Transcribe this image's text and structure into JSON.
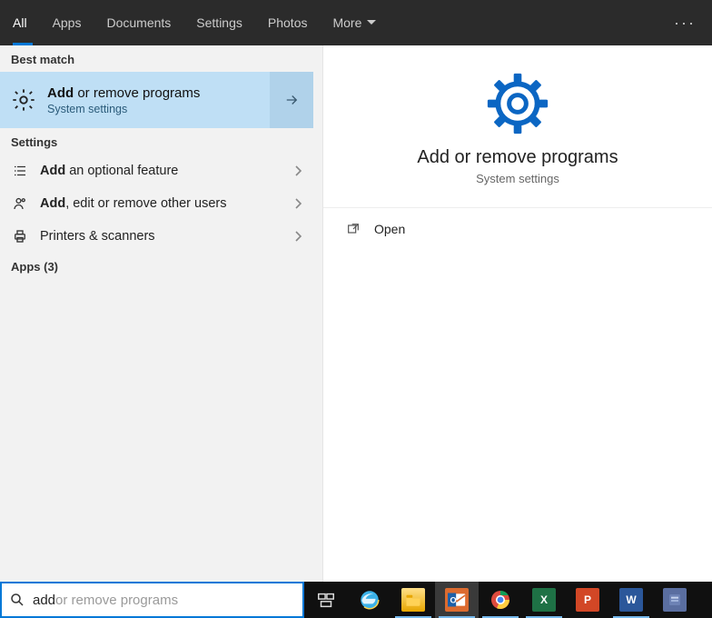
{
  "tabs": {
    "items": [
      "All",
      "Apps",
      "Documents",
      "Settings",
      "Photos",
      "More"
    ],
    "active_index": 0
  },
  "sections": {
    "best_match": "Best match",
    "settings": "Settings",
    "apps": "Apps (3)"
  },
  "best": {
    "title_bold": "Add",
    "title_rest": " or remove programs",
    "subtitle": "System settings"
  },
  "settings_rows": [
    {
      "icon": "list",
      "bold": "Add",
      "rest": " an optional feature"
    },
    {
      "icon": "user",
      "bold": "Add",
      "rest": ", edit or remove other users"
    },
    {
      "icon": "printer",
      "bold": "",
      "rest": "Printers & scanners"
    }
  ],
  "detail": {
    "title": "Add or remove programs",
    "subtitle": "System settings",
    "actions": [
      {
        "icon": "open",
        "label": "Open"
      }
    ]
  },
  "search": {
    "typed": "add",
    "ghost": " or remove programs"
  },
  "taskbar": {
    "items": [
      {
        "name": "task-view",
        "kind": "taskview",
        "running": false
      },
      {
        "name": "internet-explorer",
        "kind": "ie",
        "running": false
      },
      {
        "name": "file-explorer",
        "kind": "explorer",
        "running": true
      },
      {
        "name": "outlook",
        "kind": "outlook",
        "running": true,
        "active": true
      },
      {
        "name": "chrome",
        "kind": "chrome",
        "running": true
      },
      {
        "name": "excel",
        "kind": "excel",
        "running": true
      },
      {
        "name": "powerpoint",
        "kind": "ppt",
        "running": false
      },
      {
        "name": "word",
        "kind": "word",
        "running": true
      },
      {
        "name": "app-unknown",
        "kind": "misc",
        "running": false
      }
    ]
  },
  "colors": {
    "accent": "#0078d7",
    "excel": "#1e7145",
    "ppt": "#d24726",
    "word": "#2b579a",
    "outlook": "#dc6b2f",
    "explorer": "#ffcc33"
  }
}
